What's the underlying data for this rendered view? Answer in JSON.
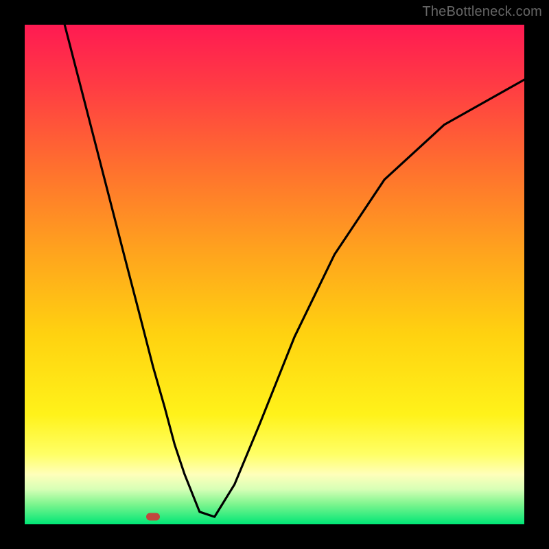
{
  "attribution": "TheBottleneck.com",
  "colors": {
    "frame": "#000000",
    "curve": "#000000",
    "marker": "#c1463e",
    "attribution_text": "#666666",
    "gradient_stops": [
      {
        "offset": 0.0,
        "color": "#ff1a52"
      },
      {
        "offset": 0.12,
        "color": "#ff3b44"
      },
      {
        "offset": 0.28,
        "color": "#ff6e2f"
      },
      {
        "offset": 0.45,
        "color": "#ffa21e"
      },
      {
        "offset": 0.62,
        "color": "#ffd210"
      },
      {
        "offset": 0.78,
        "color": "#fff21a"
      },
      {
        "offset": 0.86,
        "color": "#ffff66"
      },
      {
        "offset": 0.9,
        "color": "#ffffba"
      },
      {
        "offset": 0.93,
        "color": "#d7ffb6"
      },
      {
        "offset": 0.96,
        "color": "#7cf58e"
      },
      {
        "offset": 1.0,
        "color": "#00e676"
      }
    ]
  },
  "chart_data": {
    "type": "line",
    "title": "",
    "xlabel": "",
    "ylabel": "",
    "xlim": [
      0,
      100
    ],
    "ylim": [
      0,
      100
    ],
    "grid": false,
    "legend": false,
    "note": "Values estimated from pixel positions; chart has no tick labels.",
    "series": [
      {
        "name": "curve",
        "x": [
          8.0,
          12.0,
          16.0,
          20.0,
          23.0,
          25.7,
          28.0,
          30.0,
          32.0,
          35.0,
          38.0,
          42.0,
          47.0,
          54.0,
          62.0,
          72.0,
          84.0,
          100.0
        ],
        "y": [
          100.0,
          84.5,
          69.0,
          53.5,
          42.0,
          31.5,
          23.5,
          16.0,
          10.0,
          2.5,
          1.5,
          8.0,
          20.0,
          37.5,
          54.0,
          69.0,
          80.0,
          89.0
        ]
      }
    ],
    "marker": {
      "x": 25.7,
      "y": 1.5,
      "color": "#c1463e"
    }
  }
}
